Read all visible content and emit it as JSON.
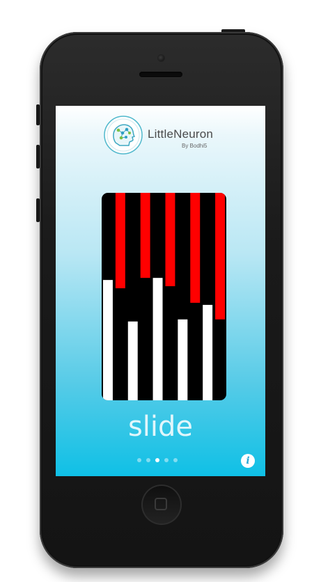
{
  "app": {
    "title": "LittleNeuron",
    "subtitle": "By Bodhi5"
  },
  "board": {
    "colors": {
      "background": "#000000",
      "top_bar": "#ff0000",
      "bottom_bar": "#ffffff"
    },
    "columns": [
      {
        "top_fill": 0.0,
        "bottom_fill": 0.58
      },
      {
        "top_fill": 0.46,
        "bottom_fill": 0.0
      },
      {
        "top_fill": 0.0,
        "bottom_fill": 0.38
      },
      {
        "top_fill": 0.41,
        "bottom_fill": 0.0
      },
      {
        "top_fill": 0.0,
        "bottom_fill": 0.59
      },
      {
        "top_fill": 0.45,
        "bottom_fill": 0.0
      },
      {
        "top_fill": 0.0,
        "bottom_fill": 0.39
      },
      {
        "top_fill": 0.53,
        "bottom_fill": 0.0
      },
      {
        "top_fill": 0.0,
        "bottom_fill": 0.46
      },
      {
        "top_fill": 0.61,
        "bottom_fill": 0.0
      }
    ]
  },
  "mode_label": "slide",
  "pager": {
    "count": 5,
    "active_index": 2
  },
  "info_button": {
    "label": "i"
  },
  "colors": {
    "accent": "#0fc0e6",
    "phone": "#1a1a1a"
  }
}
